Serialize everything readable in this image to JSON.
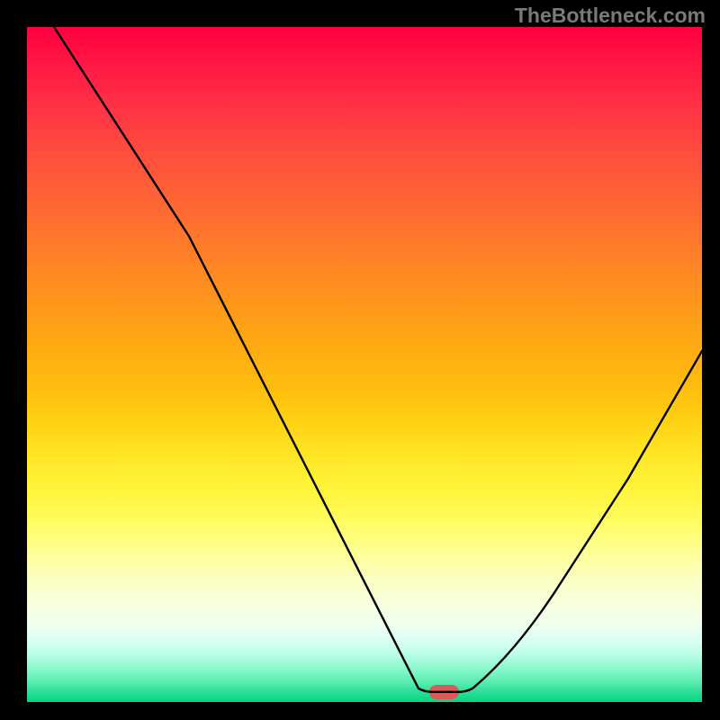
{
  "watermark": "TheBottleneck.com",
  "gradient_colors": {
    "top": "#ff0040",
    "mid": "#ffd900",
    "bottom": "#00d682"
  },
  "marker": {
    "color": "#d85a5a",
    "x_frac": 0.618,
    "y_frac": 0.985,
    "w_frac": 0.045,
    "h_frac": 0.022
  },
  "chart_data": {
    "type": "line",
    "title": "",
    "xlabel": "",
    "ylabel": "",
    "xlim": [
      0,
      1
    ],
    "ylim": [
      0,
      1
    ],
    "grid": false,
    "legend": false,
    "series": [
      {
        "name": "bottleneck-curve",
        "color": "#000000",
        "points": [
          {
            "x": 0.04,
            "y": 1.0
          },
          {
            "x": 0.24,
            "y": 0.69
          },
          {
            "x": 0.58,
            "y": 0.02
          },
          {
            "x": 0.6,
            "y": 0.015
          },
          {
            "x": 0.64,
            "y": 0.015
          },
          {
            "x": 0.66,
            "y": 0.02
          },
          {
            "x": 0.78,
            "y": 0.16
          },
          {
            "x": 0.89,
            "y": 0.33
          },
          {
            "x": 1.0,
            "y": 0.52
          }
        ]
      }
    ],
    "annotations": [
      {
        "type": "marker",
        "x": 0.62,
        "y": 0.985,
        "shape": "rounded-rect",
        "color": "#d85a5a"
      }
    ]
  }
}
